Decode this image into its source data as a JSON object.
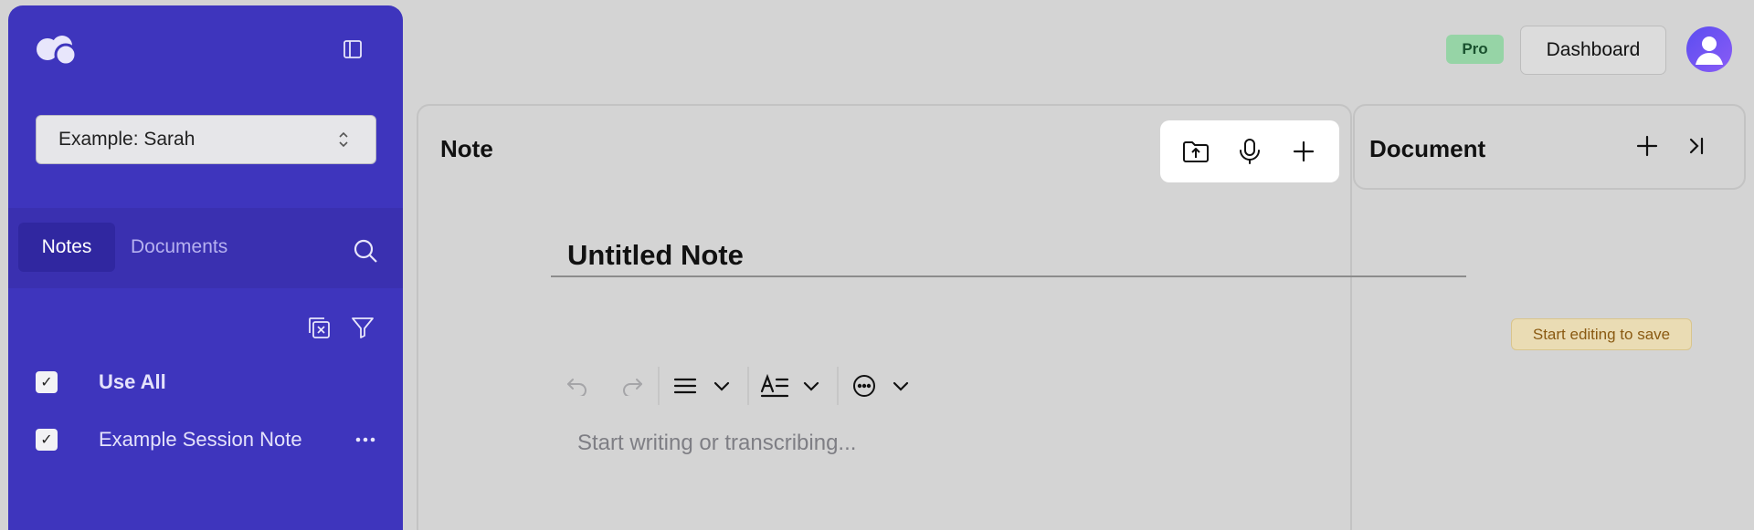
{
  "sidebar": {
    "logo_icon": "app-logo-icon",
    "collapse_icon": "sidebar-collapse-icon",
    "client_select": {
      "value": "Example: Sarah",
      "icon": "chevron-up-down-icon"
    },
    "tabs": [
      {
        "label": "Notes",
        "active": true
      },
      {
        "label": "Documents",
        "active": false
      }
    ],
    "search_icon": "search-icon",
    "tools": {
      "clear_icon": "clear-selection-icon",
      "filter_icon": "filter-icon"
    },
    "items": [
      {
        "label": "Use All",
        "checked": true,
        "bold": true
      },
      {
        "label": "Example Session Note",
        "checked": true,
        "bold": false,
        "more_icon": "more-horizontal-icon"
      }
    ],
    "bg_color": "#3e35bd"
  },
  "header": {
    "badge": "Pro",
    "dashboard_label": "Dashboard",
    "avatar_icon": "user-avatar-icon"
  },
  "note": {
    "title": "Note",
    "actions": [
      "upload-folder-icon",
      "microphone-icon",
      "plus-icon"
    ],
    "note_title_value": "Untitled Note",
    "save_status": "Start editing to save",
    "toolbar": [
      "undo-icon",
      "redo-icon",
      "align-icon",
      "text-style-icon",
      "more-circle-icon"
    ],
    "placeholder": "Start writing or transcribing..."
  },
  "document": {
    "title": "Document",
    "add_icon": "plus-icon",
    "close_icon": "collapse-right-icon"
  }
}
